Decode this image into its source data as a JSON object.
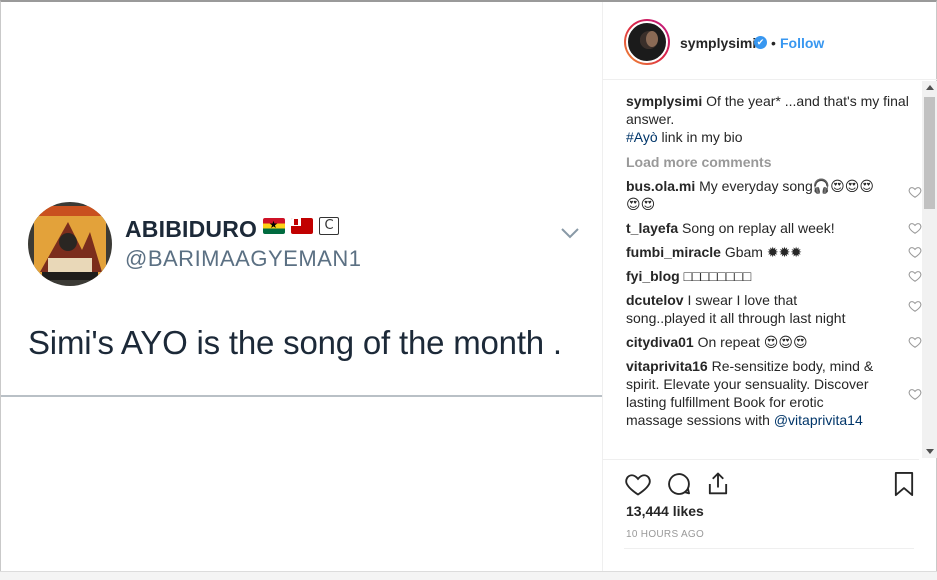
{
  "post": {
    "image": {
      "tweet": {
        "name": "ABIBIDURO",
        "c_badge": "C",
        "handle": "@BARIMAAGYEMAN1",
        "text": "Simi's AYO is the song of the month ."
      }
    }
  },
  "header": {
    "username": "symplysimi",
    "separator": "•",
    "follow_label": "Follow"
  },
  "caption": {
    "username": "symplysimi",
    "text": "Of the year* ...and that's my final answer.",
    "hashtag": "#Ayò",
    "text2": " link in my bio"
  },
  "load_more_label": "Load more comments",
  "comments": [
    {
      "user": "bus.ola.mi",
      "text": "My everyday song🎧😍😍😍😍😍"
    },
    {
      "user": "t_layefa",
      "text": "Song on replay all week!"
    },
    {
      "user": "fumbi_miracle",
      "text": "Gbam ✹✹✹"
    },
    {
      "user": "fyi_blog",
      "text": "□□□□□□□□"
    },
    {
      "user": "dcutelov",
      "text": "I swear I love that song..played it all through last night"
    },
    {
      "user": "citydiva01",
      "text": "On repeat 😍😍😍"
    },
    {
      "user": "vitaprivita16",
      "text": "Re-sensitize body, mind & spirit. Elevate your sensuality. Discover lasting fulfillment Book for erotic massage sessions with ",
      "mention": "@vitaprivita14"
    }
  ],
  "likes_label": "13,444 likes",
  "time_label": "10 HOURS AGO",
  "colors": {
    "link_blue": "#3897f0",
    "hashtag": "#003569",
    "muted": "#999999",
    "text": "#262626"
  },
  "icons": [
    "heart-icon",
    "comment-icon",
    "share-icon",
    "bookmark-icon",
    "verified-icon",
    "chevron-down-icon"
  ]
}
